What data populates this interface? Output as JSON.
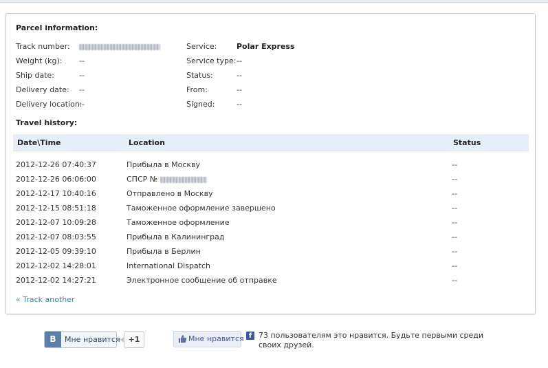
{
  "parcel": {
    "title": "Parcel information:",
    "left": [
      {
        "label": "Track number:",
        "value": "",
        "redacted": true
      },
      {
        "label": "Weight (kg):",
        "value": "--"
      },
      {
        "label": "Ship date:",
        "value": "--"
      },
      {
        "label": "Delivery date:",
        "value": "--"
      },
      {
        "label": "Delivery location:",
        "value": "--"
      }
    ],
    "right": [
      {
        "label": "Service:",
        "value": "Polar Express"
      },
      {
        "label": "Service type:",
        "value": "--"
      },
      {
        "label": "Status:",
        "value": "--"
      },
      {
        "label": "From:",
        "value": "--"
      },
      {
        "label": "Signed:",
        "value": "--"
      }
    ]
  },
  "history": {
    "title": "Travel history:",
    "columns": {
      "datetime": "Date\\Time",
      "location": "Location",
      "status": "Status"
    },
    "rows": [
      {
        "datetime": "2012-12-26 07:40:37",
        "location": "Прибыла в Москву",
        "status": "--"
      },
      {
        "datetime": "2012-12-26 06:06:00",
        "location": "СПСР №",
        "status": "--",
        "redacted": true
      },
      {
        "datetime": "2012-12-17 10:40:16",
        "location": "Отправлено в Москву",
        "status": "--"
      },
      {
        "datetime": "2012-12-15 08:51:18",
        "location": "Таможенное оформление завершено",
        "status": "--"
      },
      {
        "datetime": "2012-12-07 10:09:28",
        "location": "Таможенное оформление",
        "status": "--"
      },
      {
        "datetime": "2012-12-07 08:03:55",
        "location": "Прибыла в Калининград",
        "status": "--"
      },
      {
        "datetime": "2012-12-05 09:39:10",
        "location": "Прибыла в Берлин",
        "status": "--"
      },
      {
        "datetime": "2012-12-02 14:28:01",
        "location": "International Dispatch",
        "status": "--"
      },
      {
        "datetime": "2012-12-02 14:27:21",
        "location": "Электронное сообщение об отправке",
        "status": "--"
      }
    ]
  },
  "track_another": "« Track another",
  "social": {
    "vk_logo": "B",
    "vk_like": "Мне нравится",
    "plus_one": "+1",
    "fb_like": "Мне нравится",
    "fb_icon": "f",
    "fb_count_text": "73 пользователям это нравится. Будьте первыми среди своих друзей."
  },
  "icons": {
    "fb_like_icon": "thumbs-up-icon",
    "fb_icon": "facebook-icon",
    "vk_icon": "vk-icon"
  }
}
